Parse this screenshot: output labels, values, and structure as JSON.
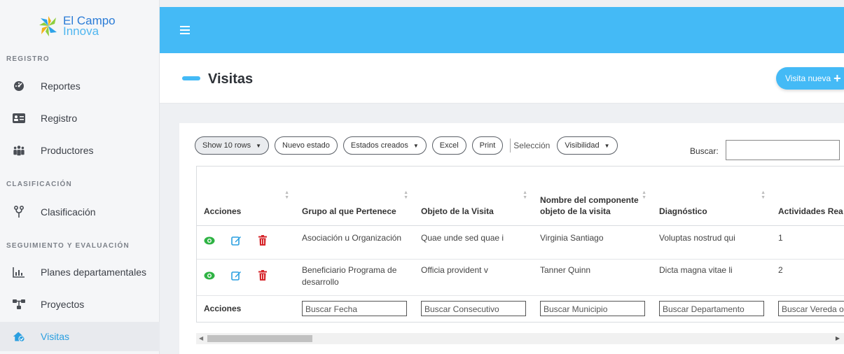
{
  "brand": {
    "line1": "El Campo",
    "line2": "Innova"
  },
  "sidebar": {
    "sections": [
      {
        "title": "REGISTRO"
      },
      {
        "title": "CLASIFICACIÓN"
      },
      {
        "title": "SEGUIMIENTO Y EVALUACIÓN"
      }
    ],
    "items": [
      {
        "label": "Reportes",
        "icon": "dashboard-icon"
      },
      {
        "label": "Registro",
        "icon": "id-card-icon"
      },
      {
        "label": "Productores",
        "icon": "users-icon"
      },
      {
        "label": "Clasificación",
        "icon": "branch-icon"
      },
      {
        "label": "Planes departamentales",
        "icon": "bar-chart-icon"
      },
      {
        "label": "Proyectos",
        "icon": "project-icon"
      },
      {
        "label": "Visitas",
        "icon": "home-check-icon",
        "active": true
      }
    ]
  },
  "header": {
    "title": "Visitas",
    "new_button": "Visita nueva"
  },
  "toolbar": {
    "show_rows": "Show 10 rows",
    "new_state": "Nuevo estado",
    "created_states": "Estados creados",
    "excel": "Excel",
    "print": "Print",
    "selection": "Selección",
    "visibility": "Visibilidad",
    "search_label": "Buscar:",
    "search_value": ""
  },
  "table": {
    "columns": [
      "Acciones",
      "Grupo al que Pertenece",
      "Objeto de la Visita",
      "Nombre del componente objeto de la visita",
      "Diagnóstico",
      "Actividades Rea"
    ],
    "rows": [
      {
        "grupo": "Asociación u Organización",
        "objeto": "Quae unde sed quae i",
        "nombre": "Virginia Santiago",
        "diagnostico": "Voluptas nostrud qui",
        "actividades": "1"
      },
      {
        "grupo": "Beneficiario Programa de desarrollo",
        "objeto": "Officia provident v",
        "nombre": "Tanner Quinn",
        "diagnostico": "Dicta magna vitae li",
        "actividades": "2"
      }
    ],
    "footer": {
      "label": "Acciones",
      "placeholders": [
        "Buscar Fecha",
        "Buscar Consecutivo",
        "Buscar Municipio",
        "Buscar Departamento",
        "Buscar Vereda o"
      ]
    }
  },
  "colors": {
    "accent": "#44baf6",
    "view": "#2fb344",
    "edit": "#2a9fe0",
    "delete": "#d6262b"
  }
}
